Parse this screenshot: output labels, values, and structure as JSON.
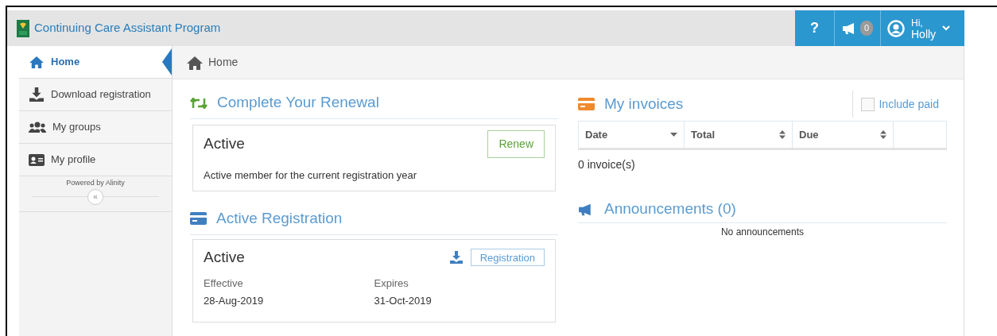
{
  "header": {
    "title": "Continuing Care Assistant Program",
    "help": "?",
    "announcement_count": "0",
    "greeting": "Hi,",
    "user": "Holly"
  },
  "sidebar": {
    "items": [
      {
        "label": "Home",
        "selected": true
      },
      {
        "label": "Download registration",
        "selected": false
      },
      {
        "label": "My groups",
        "selected": false
      },
      {
        "label": "My profile",
        "selected": false
      }
    ],
    "powered_by": "Powered by Alinity",
    "collapse": "«"
  },
  "breadcrumb": "Home",
  "renewal": {
    "title": "Complete Your Renewal",
    "status": "Active",
    "button": "Renew",
    "description": "Active member for the current registration year"
  },
  "registration": {
    "title": "Active Registration",
    "status": "Active",
    "button": "Registration",
    "effective_label": "Effective",
    "effective": "28-Aug-2019",
    "expires_label": "Expires",
    "expires": "31-Oct-2019"
  },
  "invoices": {
    "title": "My invoices",
    "include_paid": {
      "label": "Include paid",
      "checked": false
    },
    "columns": [
      {
        "label": "Date",
        "sorted": true
      },
      {
        "label": "Total",
        "sorted": false
      },
      {
        "label": "Due",
        "sorted": false
      }
    ],
    "count": "0 invoice(s)"
  },
  "announcements": {
    "title": "Announcements (0)",
    "empty": "No announcements"
  }
}
